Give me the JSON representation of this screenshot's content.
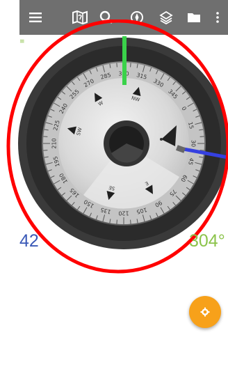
{
  "toolbar": {
    "icons": [
      "menu-icon",
      "map-icon",
      "search-icon",
      "compass-icon",
      "layers-icon",
      "folder-icon",
      "more-vert-icon"
    ]
  },
  "status": {
    "mark": "≡"
  },
  "compass": {
    "dial_labels": [
      "0",
      "15",
      "30",
      "45",
      "60",
      "75",
      "90",
      "105",
      "120",
      "135",
      "150",
      "165",
      "180",
      "195",
      "210",
      "225",
      "240",
      "255",
      "270",
      "285",
      "300",
      "315",
      "330",
      "345"
    ],
    "cardinal_labels": [
      "NW",
      "W",
      "SW",
      "SE",
      "E"
    ],
    "heading_line_color": "#3ad24a",
    "bearing_line_color": "#3540e0",
    "ring_highlight_color": "#ff0000"
  },
  "readouts": {
    "left": "42",
    "right": "304°",
    "left_color": "#3a59b7",
    "right_color": "#8bc34a"
  },
  "fab": {
    "icon": "gear-icon",
    "color": "#f7a11a"
  }
}
